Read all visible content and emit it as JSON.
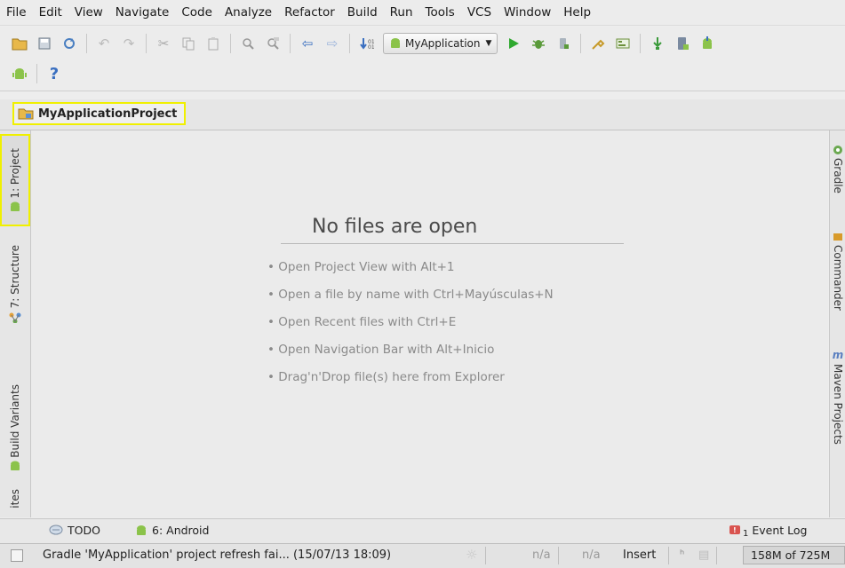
{
  "menu": [
    "File",
    "Edit",
    "View",
    "Navigate",
    "Code",
    "Analyze",
    "Refactor",
    "Build",
    "Run",
    "Tools",
    "VCS",
    "Window",
    "Help"
  ],
  "toolbar": {
    "run_config": "MyApplication",
    "help_icon": "?"
  },
  "navbar": {
    "project": "MyApplicationProject"
  },
  "left_tabs": {
    "project": "1: Project",
    "structure": "7: Structure",
    "build_variants": "Build Variants",
    "favorites": "ites"
  },
  "right_tabs": {
    "gradle": "Gradle",
    "commander": "Commander",
    "maven": "Maven Projects"
  },
  "editor": {
    "title": "No files are open",
    "hints": [
      "• Open Project View with Alt+1",
      "• Open a file by name with Ctrl+Mayúsculas+N",
      "• Open Recent files with Ctrl+E",
      "• Open Navigation Bar with Alt+Inicio",
      "• Drag'n'Drop file(s) here from Explorer"
    ]
  },
  "bottom_tabs": {
    "todo": "TODO",
    "android": "6: Android",
    "event_log": "Event Log",
    "event_badge": "1"
  },
  "status": {
    "message": "Gradle 'MyApplication' project refresh fai... (15/07/13 18:09)",
    "pos1": "n/a",
    "pos2": "n/a",
    "mode": "Insert",
    "memory": "158M of 725M"
  },
  "colors": {
    "highlight": "#f0f000",
    "android_green": "#8bc34a",
    "run_green": "#2fa82f"
  }
}
